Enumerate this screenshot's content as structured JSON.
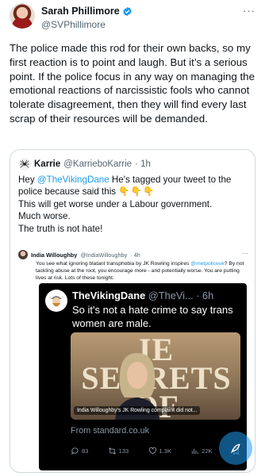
{
  "author": {
    "name": "Sarah Phillimore",
    "handle": "@SVPhillimore",
    "more": "···"
  },
  "post": {
    "text": "The police made this rod for their own backs, so my first reaction is to point and laugh. But it’s a serious point. If the police focus in any way on managing the emotional reactions of narcissistic fools who cannot tolerate disagreement, then they will find every last scrap of their resources will be demanded."
  },
  "quote": {
    "name": "Karrie",
    "handle": "@KarrieboKarrie",
    "time": "· 1h",
    "line1_prefix": "Hey ",
    "line1_mention": "@TheVikingDane",
    "line1_suffix": "  He's tagged your tweet to the police because said this ",
    "hands": "👇👇👇",
    "line2": "This will get worse under a Labour government.",
    "line3": "Much worse.",
    "line4": "The truth is not hate!"
  },
  "screenshot": {
    "name": "India Willoughby",
    "handle": "@IndiaWilloughby",
    "time": "· 4h",
    "more": "···",
    "text_prefix": "You see what ignoring blatant transphobia by JK Rowling inspires ",
    "text_mention": "@metpoliceuk",
    "text_suffix": "? By not tackling abuse at the root, you encourage more - and potentially worse. You are putting lives at risk. Lots of these tonight.",
    "inner": {
      "name": "TheVikingDane",
      "handle": "@TheVi...",
      "time": "· 6h",
      "text": "So it's not a hate crime to say trans women are male.",
      "card_letters": "IE SECRETS OF UMBLEDO",
      "card_caption": "India Willoughby's JK Rowling complaint did not...",
      "source": "From standard.co.uk",
      "replies": "83",
      "reposts": "133",
      "likes": "1.3K",
      "views": "22K"
    }
  }
}
